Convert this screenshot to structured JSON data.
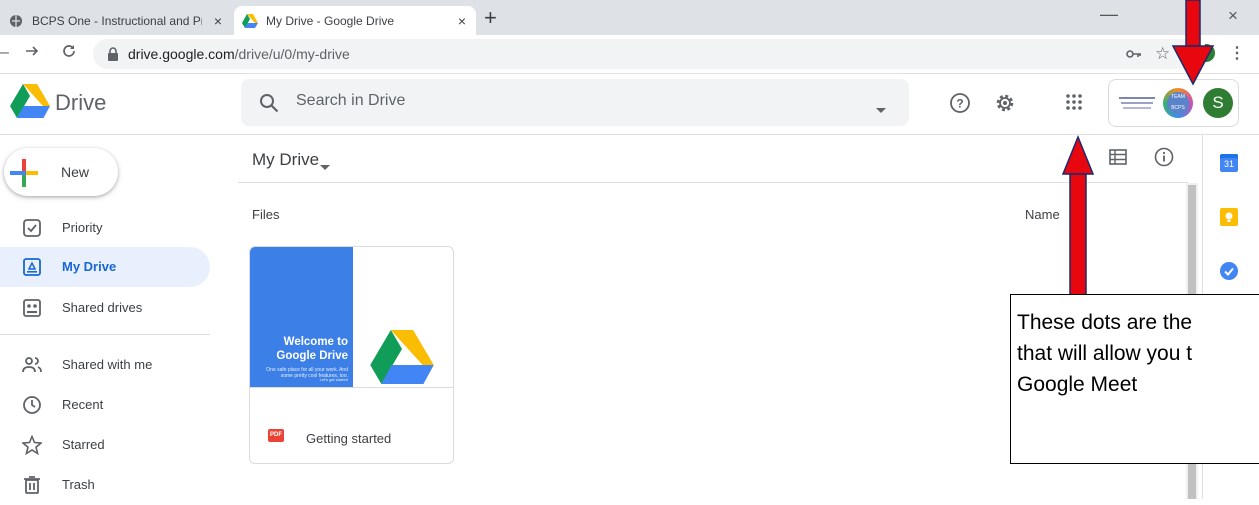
{
  "browser": {
    "tabs": [
      {
        "title": "BCPS One - Instructional and Pro",
        "close": "×"
      },
      {
        "title": "My Drive - Google Drive",
        "close": "×"
      }
    ],
    "new_tab": "+",
    "minimize": "—",
    "close_window": "×",
    "url_host": "drive.google.com",
    "url_path": "/drive/u/0/my-drive"
  },
  "drive": {
    "app_name": "Drive",
    "search_placeholder": "Search in Drive",
    "account_initial": "S",
    "badge_text": "TEAM BCPS",
    "new_label": "New",
    "nav": [
      {
        "label": "Priority",
        "icon": "priority-icon"
      },
      {
        "label": "My Drive",
        "icon": "my-drive-icon"
      },
      {
        "label": "Shared drives",
        "icon": "shared-drives-icon"
      },
      {
        "label": "Shared with me",
        "icon": "shared-with-me-icon"
      },
      {
        "label": "Recent",
        "icon": "clock-icon"
      },
      {
        "label": "Starred",
        "icon": "star-icon"
      },
      {
        "label": "Trash",
        "icon": "trash-icon"
      }
    ],
    "breadcrumb": "My Drive",
    "files_heading": "Files",
    "sort_label": "Name",
    "card": {
      "title": "Welcome to Google Drive",
      "subtitle": "One safe place for all your work. And some pretty cool features, too.",
      "link": "Let's get started",
      "file_type": "PDF",
      "file_name": "Getting started"
    },
    "side_panel": {
      "calendar_day": "31"
    }
  },
  "annotation": {
    "lines": [
      "These dots are the",
      "that will allow you t",
      "Google Meet"
    ]
  },
  "colors": {
    "accent_blue": "#1967d2",
    "arrow_red": "#e8070f",
    "drive_blue": "#4285f4",
    "drive_green": "#0f9d58",
    "drive_yellow": "#fbbc04",
    "account_green": "#2e7d32"
  }
}
